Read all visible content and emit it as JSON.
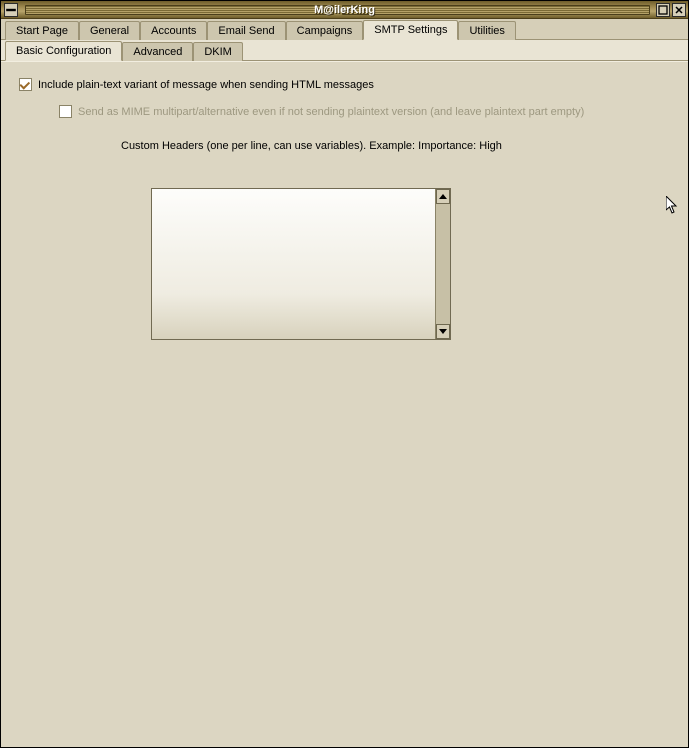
{
  "window": {
    "title": "M@ilerKing"
  },
  "tabs": {
    "main": [
      {
        "label": "Start Page",
        "active": false
      },
      {
        "label": "General",
        "active": false
      },
      {
        "label": "Accounts",
        "active": false
      },
      {
        "label": "Email Send",
        "active": false
      },
      {
        "label": "Campaigns",
        "active": false
      },
      {
        "label": "SMTP Settings",
        "active": true
      },
      {
        "label": "Utilities",
        "active": false
      }
    ],
    "sub": [
      {
        "label": "Basic Configuration",
        "active": true
      },
      {
        "label": "Advanced",
        "active": false
      },
      {
        "label": "DKIM",
        "active": false
      }
    ]
  },
  "options": {
    "include_plaintext": {
      "label": "Include plain-text variant of message when sending HTML messages",
      "checked": true
    },
    "mime_multipart": {
      "label": "Send as MIME multipart/alternative even if not sending plaintext version (and leave plaintext part empty)",
      "checked": false,
      "disabled": true
    }
  },
  "custom_headers": {
    "label": "Custom Headers (one per line, can use variables). Example: Importance: High",
    "value": ""
  }
}
